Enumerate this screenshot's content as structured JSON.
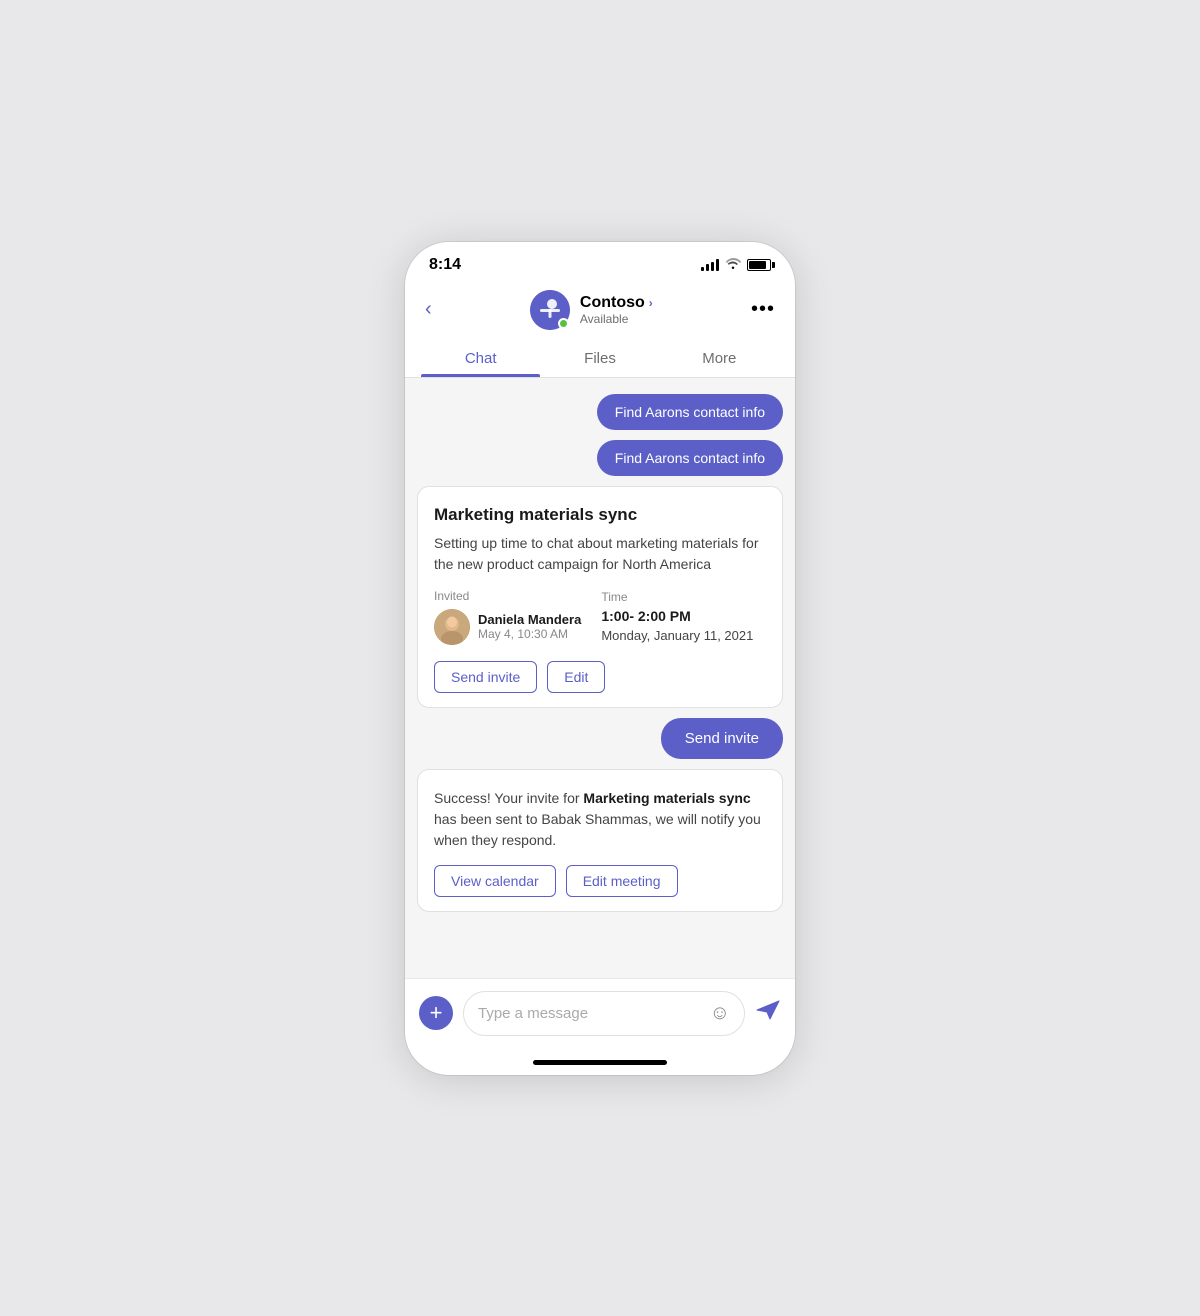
{
  "statusBar": {
    "time": "8:14"
  },
  "header": {
    "contactName": "Contoso",
    "contactStatus": "Available",
    "backLabel": "‹"
  },
  "tabs": [
    {
      "label": "Chat",
      "active": true
    },
    {
      "label": "Files",
      "active": false
    },
    {
      "label": "More",
      "active": false
    }
  ],
  "messages": {
    "bubble1": "Find Aarons contact info",
    "bubble2": "Find Aarons contact info",
    "card": {
      "title": "Marketing materials sync",
      "description": "Setting up time to chat about marketing materials for the new product campaign for North America",
      "invitedLabel": "Invited",
      "personName": "Daniela Mandera",
      "personDate": "May 4, 10:30 AM",
      "timeLabel": "Time",
      "timeRange": "1:00- 2:00 PM",
      "timeDate": "Monday, January 11, 2021",
      "sendInviteBtn": "Send invite",
      "editBtn": "Edit"
    },
    "sendInviteBubble": "Send invite",
    "successCard": {
      "text1": "Success! Your invite for ",
      "bold1": "Marketing materials sync",
      "text2": " has been sent to Babak Shammas, we will notify you when they respond.",
      "viewCalendarBtn": "View calendar",
      "editMeetingBtn": "Edit meeting"
    }
  },
  "bottomBar": {
    "addIcon": "+",
    "placeholder": "Type a message",
    "emojiIcon": "☺",
    "sendIcon": "➤"
  }
}
